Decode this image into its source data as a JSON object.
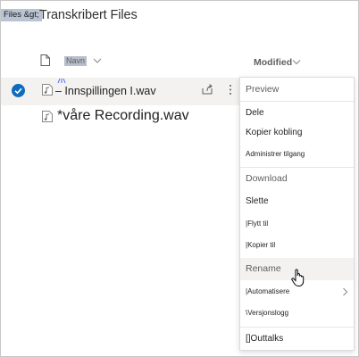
{
  "breadcrumb": {
    "previous": "Files &gt;",
    "title": "Transkribert Files"
  },
  "columns": {
    "name": "Navn",
    "modified": "Modified"
  },
  "icons": {
    "file_header": "file-icon",
    "audio_file": "audio-file-icon",
    "check": "checkmark-icon",
    "share": "share-icon",
    "more": "more-vertical-icon",
    "chevron_down": "chevron-down-icon",
    "chevron_right": "chevron-right-icon",
    "cursor": "hand-pointer-cursor-icon"
  },
  "files": [
    {
      "name": "– Innspillingen I.wav",
      "selected": true
    },
    {
      "name": "*våre Recording.wav",
      "selected": false
    }
  ],
  "context_menu": {
    "preview": "Preview",
    "share": "Dele",
    "copy_link": "Kopier kobling",
    "manage_access": "Administrer tilgang",
    "download": "Download",
    "delete": "Slette",
    "move_to": "|Flytt til",
    "copy_to": "|Kopier til",
    "rename": "Rename",
    "automate": "|Automatisere",
    "version_history": "\\Versjonslogg",
    "outtalks": "[]Outtalks"
  },
  "colors": {
    "accent": "#0f6cbd",
    "selected_row": "#f3f2f1",
    "breadcrumb_bg": "#b9c3d2"
  }
}
